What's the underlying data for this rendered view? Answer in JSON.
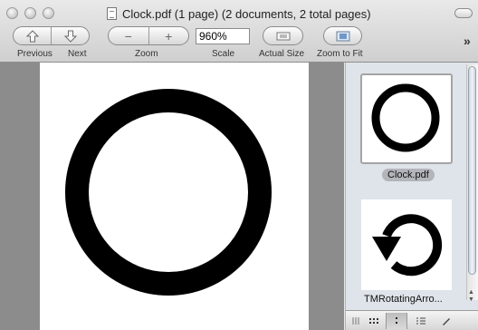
{
  "window": {
    "title": "Clock.pdf (1 page) (2 documents, 2 total pages)"
  },
  "toolbar": {
    "previous_label": "Previous",
    "next_label": "Next",
    "zoom_label": "Zoom",
    "scale_label": "Scale",
    "scale_value": "960%",
    "actual_size_label": "Actual Size",
    "zoom_to_fit_label": "Zoom to Fit",
    "zoom_out_symbol": "−",
    "zoom_in_symbol": "+"
  },
  "sidebar": {
    "documents": [
      {
        "name": "Clock.pdf",
        "icon": "ring-icon",
        "selected": true
      },
      {
        "name": "TMRotatingArro...",
        "icon": "rotating-arrow-icon",
        "selected": false
      }
    ]
  },
  "colors": {
    "document_background": "#8c8c8c",
    "sidebar_background": "#dfe4ea",
    "selected_label_bg": "#b2b5ba"
  }
}
